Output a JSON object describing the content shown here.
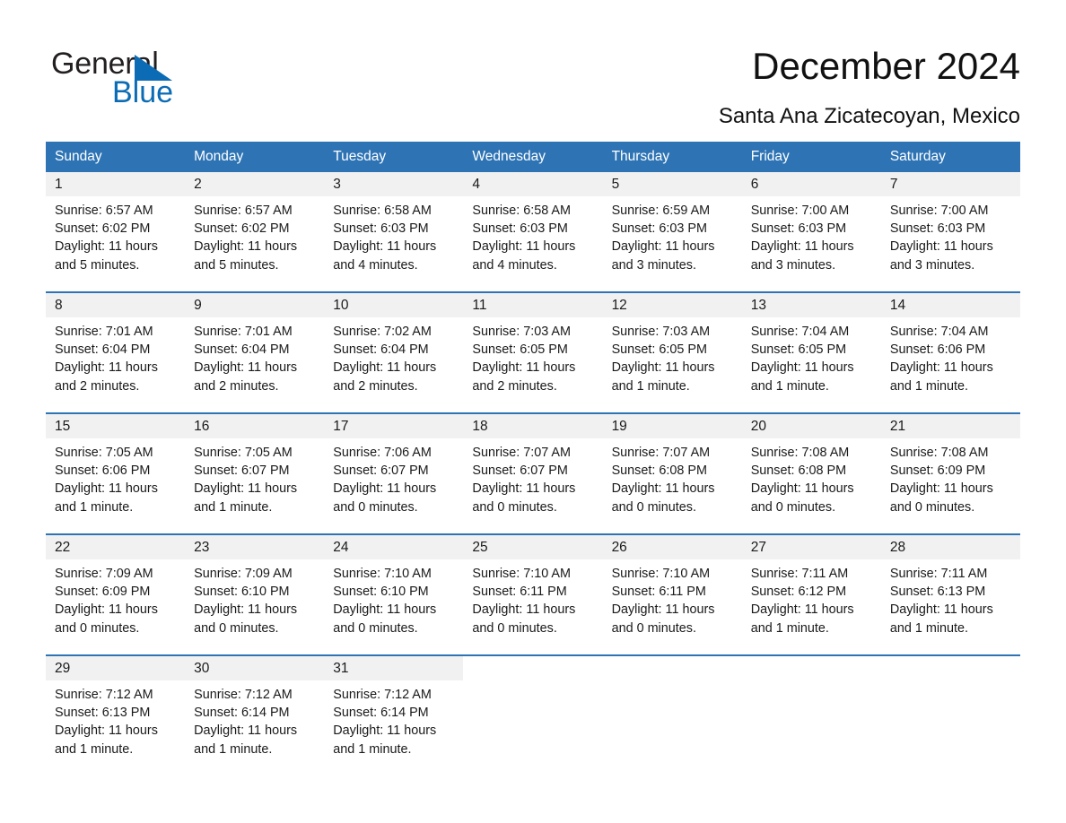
{
  "brand": {
    "logo_line1": "General",
    "logo_line2": "Blue",
    "triangle_icon": "blue-triangle-icon",
    "accent_color": "#0b6cb5"
  },
  "header": {
    "title": "December 2024",
    "subtitle": "Santa Ana Zicatecoyan, Mexico"
  },
  "theme": {
    "header_blue": "#2e74b5",
    "daynum_band": "#f1f1f1",
    "text": "#1a1a1a"
  },
  "calendar": {
    "weekday_headers": [
      "Sunday",
      "Monday",
      "Tuesday",
      "Wednesday",
      "Thursday",
      "Friday",
      "Saturday"
    ],
    "weeks": [
      [
        {
          "day": "1",
          "sunrise": "Sunrise: 6:57 AM",
          "sunset": "Sunset: 6:02 PM",
          "daylight": "Daylight: 11 hours and 5 minutes."
        },
        {
          "day": "2",
          "sunrise": "Sunrise: 6:57 AM",
          "sunset": "Sunset: 6:02 PM",
          "daylight": "Daylight: 11 hours and 5 minutes."
        },
        {
          "day": "3",
          "sunrise": "Sunrise: 6:58 AM",
          "sunset": "Sunset: 6:03 PM",
          "daylight": "Daylight: 11 hours and 4 minutes."
        },
        {
          "day": "4",
          "sunrise": "Sunrise: 6:58 AM",
          "sunset": "Sunset: 6:03 PM",
          "daylight": "Daylight: 11 hours and 4 minutes."
        },
        {
          "day": "5",
          "sunrise": "Sunrise: 6:59 AM",
          "sunset": "Sunset: 6:03 PM",
          "daylight": "Daylight: 11 hours and 3 minutes."
        },
        {
          "day": "6",
          "sunrise": "Sunrise: 7:00 AM",
          "sunset": "Sunset: 6:03 PM",
          "daylight": "Daylight: 11 hours and 3 minutes."
        },
        {
          "day": "7",
          "sunrise": "Sunrise: 7:00 AM",
          "sunset": "Sunset: 6:03 PM",
          "daylight": "Daylight: 11 hours and 3 minutes."
        }
      ],
      [
        {
          "day": "8",
          "sunrise": "Sunrise: 7:01 AM",
          "sunset": "Sunset: 6:04 PM",
          "daylight": "Daylight: 11 hours and 2 minutes."
        },
        {
          "day": "9",
          "sunrise": "Sunrise: 7:01 AM",
          "sunset": "Sunset: 6:04 PM",
          "daylight": "Daylight: 11 hours and 2 minutes."
        },
        {
          "day": "10",
          "sunrise": "Sunrise: 7:02 AM",
          "sunset": "Sunset: 6:04 PM",
          "daylight": "Daylight: 11 hours and 2 minutes."
        },
        {
          "day": "11",
          "sunrise": "Sunrise: 7:03 AM",
          "sunset": "Sunset: 6:05 PM",
          "daylight": "Daylight: 11 hours and 2 minutes."
        },
        {
          "day": "12",
          "sunrise": "Sunrise: 7:03 AM",
          "sunset": "Sunset: 6:05 PM",
          "daylight": "Daylight: 11 hours and 1 minute."
        },
        {
          "day": "13",
          "sunrise": "Sunrise: 7:04 AM",
          "sunset": "Sunset: 6:05 PM",
          "daylight": "Daylight: 11 hours and 1 minute."
        },
        {
          "day": "14",
          "sunrise": "Sunrise: 7:04 AM",
          "sunset": "Sunset: 6:06 PM",
          "daylight": "Daylight: 11 hours and 1 minute."
        }
      ],
      [
        {
          "day": "15",
          "sunrise": "Sunrise: 7:05 AM",
          "sunset": "Sunset: 6:06 PM",
          "daylight": "Daylight: 11 hours and 1 minute."
        },
        {
          "day": "16",
          "sunrise": "Sunrise: 7:05 AM",
          "sunset": "Sunset: 6:07 PM",
          "daylight": "Daylight: 11 hours and 1 minute."
        },
        {
          "day": "17",
          "sunrise": "Sunrise: 7:06 AM",
          "sunset": "Sunset: 6:07 PM",
          "daylight": "Daylight: 11 hours and 0 minutes."
        },
        {
          "day": "18",
          "sunrise": "Sunrise: 7:07 AM",
          "sunset": "Sunset: 6:07 PM",
          "daylight": "Daylight: 11 hours and 0 minutes."
        },
        {
          "day": "19",
          "sunrise": "Sunrise: 7:07 AM",
          "sunset": "Sunset: 6:08 PM",
          "daylight": "Daylight: 11 hours and 0 minutes."
        },
        {
          "day": "20",
          "sunrise": "Sunrise: 7:08 AM",
          "sunset": "Sunset: 6:08 PM",
          "daylight": "Daylight: 11 hours and 0 minutes."
        },
        {
          "day": "21",
          "sunrise": "Sunrise: 7:08 AM",
          "sunset": "Sunset: 6:09 PM",
          "daylight": "Daylight: 11 hours and 0 minutes."
        }
      ],
      [
        {
          "day": "22",
          "sunrise": "Sunrise: 7:09 AM",
          "sunset": "Sunset: 6:09 PM",
          "daylight": "Daylight: 11 hours and 0 minutes."
        },
        {
          "day": "23",
          "sunrise": "Sunrise: 7:09 AM",
          "sunset": "Sunset: 6:10 PM",
          "daylight": "Daylight: 11 hours and 0 minutes."
        },
        {
          "day": "24",
          "sunrise": "Sunrise: 7:10 AM",
          "sunset": "Sunset: 6:10 PM",
          "daylight": "Daylight: 11 hours and 0 minutes."
        },
        {
          "day": "25",
          "sunrise": "Sunrise: 7:10 AM",
          "sunset": "Sunset: 6:11 PM",
          "daylight": "Daylight: 11 hours and 0 minutes."
        },
        {
          "day": "26",
          "sunrise": "Sunrise: 7:10 AM",
          "sunset": "Sunset: 6:11 PM",
          "daylight": "Daylight: 11 hours and 0 minutes."
        },
        {
          "day": "27",
          "sunrise": "Sunrise: 7:11 AM",
          "sunset": "Sunset: 6:12 PM",
          "daylight": "Daylight: 11 hours and 1 minute."
        },
        {
          "day": "28",
          "sunrise": "Sunrise: 7:11 AM",
          "sunset": "Sunset: 6:13 PM",
          "daylight": "Daylight: 11 hours and 1 minute."
        }
      ],
      [
        {
          "day": "29",
          "sunrise": "Sunrise: 7:12 AM",
          "sunset": "Sunset: 6:13 PM",
          "daylight": "Daylight: 11 hours and 1 minute."
        },
        {
          "day": "30",
          "sunrise": "Sunrise: 7:12 AM",
          "sunset": "Sunset: 6:14 PM",
          "daylight": "Daylight: 11 hours and 1 minute."
        },
        {
          "day": "31",
          "sunrise": "Sunrise: 7:12 AM",
          "sunset": "Sunset: 6:14 PM",
          "daylight": "Daylight: 11 hours and 1 minute."
        },
        {
          "day": "",
          "sunrise": "",
          "sunset": "",
          "daylight": ""
        },
        {
          "day": "",
          "sunrise": "",
          "sunset": "",
          "daylight": ""
        },
        {
          "day": "",
          "sunrise": "",
          "sunset": "",
          "daylight": ""
        },
        {
          "day": "",
          "sunrise": "",
          "sunset": "",
          "daylight": ""
        }
      ]
    ]
  }
}
